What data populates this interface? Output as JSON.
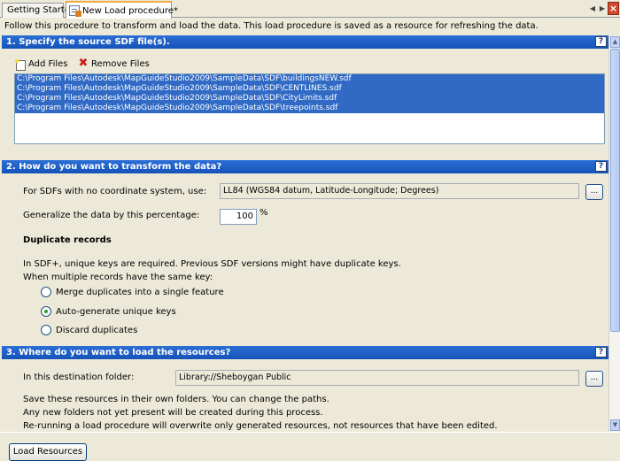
{
  "tabs": [
    {
      "label": "Getting Started"
    },
    {
      "label": "New Load procedure*"
    }
  ],
  "intro": "Follow this procedure to transform and load the data. This load procedure is saved as a resource for refreshing the data.",
  "section1": {
    "title": "1. Specify the source SDF file(s).",
    "add_files": "Add Files",
    "remove_files": "Remove Files",
    "files": [
      "C:\\Program Files\\Autodesk\\MapGuideStudio2009\\SampleData\\SDF\\buildingsNEW.sdf",
      "C:\\Program Files\\Autodesk\\MapGuideStudio2009\\SampleData\\SDF\\CENTLINES.sdf",
      "C:\\Program Files\\Autodesk\\MapGuideStudio2009\\SampleData\\SDF\\CityLimits.sdf",
      "C:\\Program Files\\Autodesk\\MapGuideStudio2009\\SampleData\\SDF\\treepoints.sdf"
    ]
  },
  "section2": {
    "title": "2. How do you want to transform the data?",
    "coord_label": "For SDFs with no coordinate system, use:",
    "coord_value": "LL84 (WGS84 datum, Latitude-Longitude; Degrees)",
    "browse": "...",
    "generalize_label": "Generalize the data by this percentage:",
    "generalize_value": "100",
    "pct_sign": "%",
    "dup_heading": "Duplicate records",
    "note1": "In SDF+, unique keys are required. Previous SDF versions might have duplicate keys.",
    "note2": "When multiple records have the same key:",
    "options": [
      {
        "label": "Merge duplicates into a single feature",
        "checked": false
      },
      {
        "label": "Auto-generate unique keys",
        "checked": true
      },
      {
        "label": "Discard duplicates",
        "checked": false
      }
    ]
  },
  "section3": {
    "title": "3. Where do you want to load the resources?",
    "folder_label": "In this destination folder:",
    "folder_value": "Library://Sheboygan Public",
    "browse": "...",
    "line1": "Save these resources in their own folders. You can change the paths.",
    "line2": "Any new folders not yet present will be created during this process.",
    "line3": "Re-running a load procedure will overwrite only generated resources, not resources that have been edited."
  },
  "help": "?",
  "load_button": "Load Resources"
}
